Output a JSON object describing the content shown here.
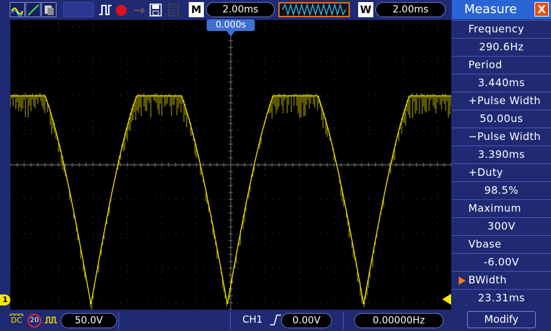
{
  "toolbar": {
    "timebase_marker": "M",
    "timebase_value": "2.00ms",
    "window_marker": "W",
    "window_value": "2.00ms"
  },
  "screen": {
    "trigger_position": "0.000s",
    "channel_marker": "1",
    "trace_color": "#f6e800",
    "grid_color": "#4a4a4a"
  },
  "bottom": {
    "coupling": "DC",
    "bandwidth_limit": "20",
    "volts_per_div": "50.0V",
    "trigger_source": "CH1",
    "trigger_level": "0.00V",
    "frequency_counter": "0.00000Hz"
  },
  "panel": {
    "title": "Measure",
    "close_label": "X",
    "measurements": [
      {
        "label": "Frequency",
        "value": "290.6Hz"
      },
      {
        "label": "Period",
        "value": "3.440ms"
      },
      {
        "label": "+Pulse Width",
        "value": "50.00us"
      },
      {
        "label": "−Pulse Width",
        "value": "3.390ms"
      },
      {
        "label": "+Duty",
        "value": "98.5%"
      },
      {
        "label": "Maximum",
        "value": "300V"
      },
      {
        "label": "Vbase",
        "value": "-6.00V"
      },
      {
        "label": "BWidth",
        "value": "23.31ms"
      }
    ],
    "modify_label": "Modify"
  }
}
